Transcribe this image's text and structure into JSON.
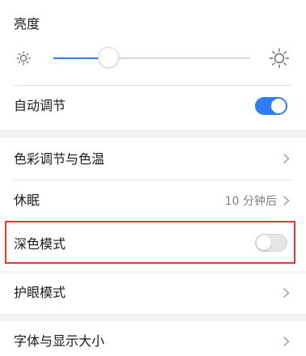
{
  "brightness": {
    "title": "亮度",
    "level_percent": 28,
    "min_icon": "sun-small-icon",
    "max_icon": "sun-large-icon"
  },
  "auto_adjust": {
    "label": "自动调节",
    "enabled": true
  },
  "color_temp": {
    "label": "色彩调节与色温",
    "icon": "chevron-right-icon"
  },
  "sleep": {
    "label": "休眠",
    "value": "10 分钟后",
    "icon": "chevron-right-icon"
  },
  "dark_mode": {
    "label": "深色模式",
    "enabled": false
  },
  "eye_comfort": {
    "label": "护眼模式",
    "icon": "chevron-right-icon"
  },
  "font_display": {
    "label": "字体与显示大小",
    "icon": "chevron-right-icon"
  },
  "colors": {
    "accent": "#2f7cf6",
    "highlight_border": "#e53935",
    "background": "#f2f2f2"
  }
}
